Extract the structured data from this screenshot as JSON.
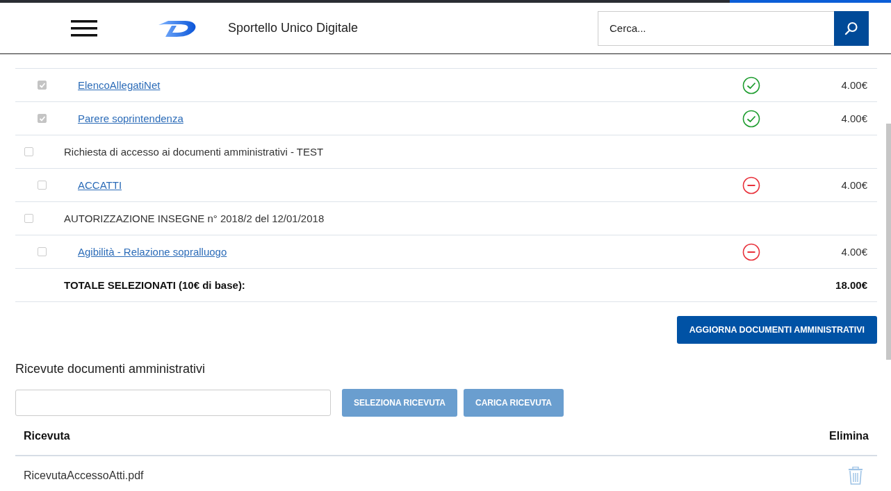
{
  "header": {
    "title": "Sportello Unico Digitale",
    "search": {
      "placeholder": "Cerca..."
    }
  },
  "documents": [
    {
      "kind": "item",
      "label": "ElencoAllegatiNet",
      "checked": true,
      "verified": true,
      "price": "4.00€"
    },
    {
      "kind": "item",
      "label": "Parere soprintendenza",
      "checked": true,
      "verified": true,
      "price": "4.00€"
    },
    {
      "kind": "group",
      "label": "Richiesta di accesso ai documenti amministrativi - TEST",
      "checked": false
    },
    {
      "kind": "item",
      "label": "ACCATTI",
      "checked": false,
      "verified": false,
      "price": "4.00€"
    },
    {
      "kind": "group",
      "label": "AUTORIZZAZIONE INSEGNE n° 2018/2 del 12/01/2018",
      "checked": false
    },
    {
      "kind": "item",
      "label": "Agibilità - Relazione sopralluogo",
      "checked": false,
      "verified": false,
      "price": "4.00€"
    }
  ],
  "total": {
    "label": "TOTALE SELEZIONATI (10€ di base):",
    "value": "18.00€"
  },
  "update_button": "AGGIORNA DOCUMENTI AMMINISTRATIVI",
  "receipts": {
    "title": "Ricevute documenti amministrativi",
    "buttons": [
      "SELEZIONA RICEVUTA",
      "CARICA RICEVUTA"
    ],
    "columns": [
      "Ricevuta",
      "Elimina"
    ],
    "rows": [
      {
        "name": "RicevutaAccessoAtti.pdf"
      }
    ]
  }
}
